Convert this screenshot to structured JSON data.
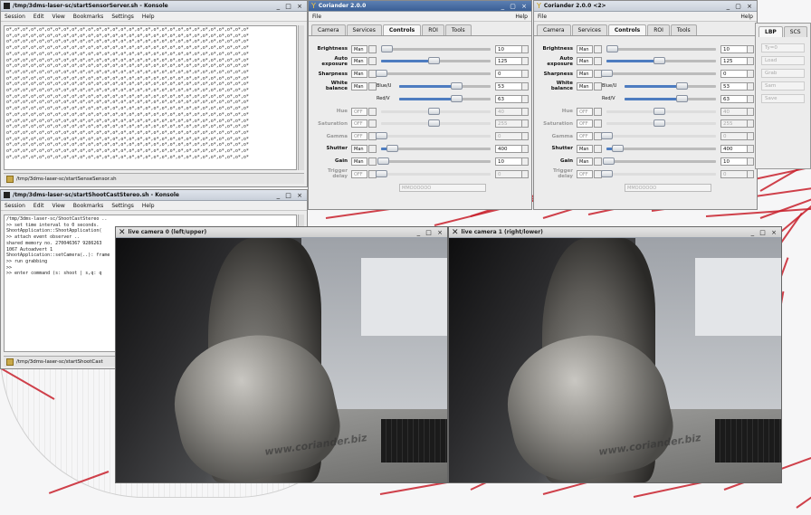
{
  "konsole1": {
    "title": "/tmp/3dms-laser-sc/startSensorServer.sh - Konsole",
    "buttons": "_ □ ×",
    "menu": [
      "Session",
      "Edit",
      "View",
      "Bookmarks",
      "Settings",
      "Help"
    ],
    "tab_label": "/tmp/3dms-laser-sc/startSenseSensor.sh",
    "lines": [
      "o*,o*,o*,o*,o*,o*,o*,o*,o*,o*,o*,o*,o*,o*,o*,o*,o*,o*,o*,o*,o*,o*,o*,o*,o*,o*,o*,o*,o*,o*",
      "o*,o*,o*,o*,o*,o*,o*,o*,o*,o*,o*,o*,o*,o*,o*,o*,o*,o*,o*,o*,o*,o*,o*,o*,o*,o*,o*,o*,o*,o*",
      "o*,o*,o*,o*,o*,o*,o*,o*,o*,o*,o*,o*,o*,o*,o*,o*,o*,o*,o*,o*,o*,o*,o*,o*,o*,o*,o*,o*,o*,o*",
      "o*,o*,o*,o*,o*,o*,o*,o*,o*,o*,o*,o*,o*,o*,o*,o*,o*,o*,o*,o*,o*,o*,o*,o*,o*,o*,o*,o*,o*,o*",
      "o*,o*,o*,o*,o*,o*,o*,o*,o*,o*,o*,o*,o*,o*,o*,o*,o*,o*,o*,o*,o*,o*,o*,o*,o*,o*,o*,o*,o*,o*",
      "o*,o*,o*,o*,o*,o*,o*,o*,o*,o*,o*,o*,o*,o*,o*,o*,o*,o*,o*,o*,o*,o*,o*,o*,o*,o*,o*,o*,o*,o*",
      "o*,o*,o*,o*,o*,o*,o*,o*,o*,o*,o*,o*,o*,o*,o*,o*,o*,o*,o*,o*,o*,o*,o*,o*,o*,o*,o*,o*,o*,o*",
      "o*,o*,o*,o*,o*,o*,o*,o*,o*,o*,o*,o*,o*,o*,o*,o*,o*,o*,o*,o*,o*,o*,o*,o*,o*,o*,o*,o*,o*,o*",
      "o*,o*,o*,o*,o*,o*,o*,o*,o*,o*,o*,o*,o*,o*,o*,o*,o*,o*,o*,o*,o*,o*,o*,o*,o*,o*,o*,o*,o*,o*",
      "o*,o*,o*,o*,o*,o*,o*,o*,o*,o*,o*,o*,o*,o*,o*,o*,o*,o*,o*,o*,o*,o*,o*,o*,o*,o*,o*,o*,o*,o*",
      "o*,o*,o*,o*,o*,o*,o*,o*,o*,o*,o*,o*,o*,o*,o*,o*,o*,o*,o*,o*,o*,o*,o*,o*,o*,o*,o*,o*,o*,o*",
      "o*,o*,o*,o*,o*,o*,o*,o*,o*,o*,o*,o*,o*,o*,o*,o*,o*,o*,o*,o*,o*,o*,o*,o*,o*,o*,o*,o*,o*,o*",
      "o*,o*,o*,o*,o*,o*,o*,o*,o*,o*,o*,o*,o*,o*,o*,o*,o*,o*,o*,o*,o*,o*,o*,o*,o*,o*,o*,o*,o*,o*",
      "o*,o*,o*,o*,o*,o*,o*,o*,o*,o*,o*,o*,o*,o*,o*,o*,o*,o*,o*,o*,o*,o*,o*,o*,o*,o*,o*,o*,o*,o*",
      "o*,o*,o*,o*,o*,o*,o*,o*,o*,o*,o*,o*,o*,o*,o*,o*,o*,o*,o*,o*,o*,o*,o*,o*,o*,o*,o*,o*,o*,o*",
      "o*,o*,o*,o*,o*,o*,o*,o*,o*,o*,o*,o*,o*,o*,o*,o*,o*,o*,o*,o*,o*,o*,o*,o*,o*,o*,o*,o*,o*,o*",
      "o*,o*,o*,o*,o*,o*,o*,o*,o*,o*,o*,o*,o*,o*,o*,o*,o*,o*,o*,o*,o*,o*,o*,o*,o*,o*,o*,o*,o*,o*",
      "o*,o*,o*,o*,o*,o*,o*,o*,o*,o*,o*,o*,o*,o*,o*,o*,o*,o*,o*,o*,o*,o*,o*,o*,o*,o*,o*,o*,o*,o*",
      "o*,o*,o*,o*,o*,o*,o*,o*,o*,o*,o*,o*,o*,o*,o*,o*,o*,o*,o*,o*,o*,o*,o*,o*,o*,o*,o*,o*,o*,o*",
      "o*,o*,o*,o*,o*,o*,o*,o*,o*,o*,o*,o*,o*,o*,o*,o*,o*,o*,o*,o*,o*,o*,o*,o*,o*,o*,o*,o*,o*,o*",
      "o*,o*,o*,o*,o*,o*,o*,o*,o*,o*,o*,o*,o*,o*,o*,o*,o*,o*,o*,o*,o*,o*,o*,o*,o*,o*,o*,o*,o*,o*",
      "o*,o*,o*,o*,o*,o*,o*,o*,o*,o*,o*,o*,o*,o*,o*,o*,o*,o*,o*,o*,o*,o*,o*,o*,o*,o*,o*,o*,o*,o*"
    ]
  },
  "konsole2": {
    "title": "/tmp/3dms-laser-sc/startShootCastStereo.sh - Konsole",
    "buttons": "_ □ ×",
    "menu": [
      "Session",
      "Edit",
      "View",
      "Bookmarks",
      "Settings",
      "Help"
    ],
    "tab_label": "/tmp/3dms-laser-sc/startShootCast",
    "lines": [
      "/tmp/3dms-laser-sc/ShootCastStereo ..",
      ">> set time interval to 0 seconds.",
      "ShootApplication::ShootApplication(",
      ">> attach event observer ..",
      "shared memory no. 270046367 9286263",
      "1067 Autoadvert 1",
      "ShootApplication::setCamera(..): frame",
      ">> run grabbing",
      ">>",
      ">> enter command (s: shoot | s,q: q"
    ]
  },
  "coriander1": {
    "title": "Coriander 2.0.0",
    "file_menu": "File",
    "help_menu": "Help",
    "tabs": [
      "Camera",
      "Services",
      "Controls",
      "ROI",
      "Tools"
    ],
    "rows": [
      {
        "label": "Brightness",
        "mode": "Man",
        "value": "10",
        "pos": 0.05,
        "disabled": false
      },
      {
        "label": "Auto exposure",
        "mode": "Man",
        "value": "125",
        "pos": 0.48,
        "disabled": false
      },
      {
        "label": "Sharpness",
        "mode": "Man",
        "value": "0",
        "pos": 0.0,
        "disabled": false
      },
      {
        "label": "White balance",
        "mode": "Man",
        "value": "53",
        "pos": 0.62,
        "chan": "Blue/U",
        "disabled": false
      },
      {
        "label": "",
        "mode": "",
        "value": "63",
        "pos": 0.62,
        "chan": "Red/V",
        "disabled": false
      },
      {
        "label": "Hue",
        "mode": "OFF",
        "value": "40",
        "pos": 0.48,
        "disabled": true
      },
      {
        "label": "Saturation",
        "mode": "OFF",
        "value": "255",
        "pos": 0.48,
        "disabled": true
      },
      {
        "label": "Gamma",
        "mode": "OFF",
        "value": "0",
        "pos": 0.0,
        "disabled": true
      },
      {
        "label": "Shutter",
        "mode": "Man",
        "value": "400",
        "pos": 0.1,
        "disabled": false
      },
      {
        "label": "Gain",
        "mode": "Man",
        "value": "10",
        "pos": 0.02,
        "disabled": false
      },
      {
        "label": "Trigger delay",
        "mode": "OFF",
        "value": "0",
        "pos": 0.0,
        "disabled": true
      }
    ],
    "trigger_field": "MMOOOOOO"
  },
  "coriander2": {
    "title": "Coriander 2.0.0 <2>",
    "file_menu": "File",
    "help_menu": "Help",
    "tabs": [
      "Camera",
      "Services",
      "Controls",
      "ROI",
      "Tools"
    ],
    "rows": [
      {
        "label": "Brightness",
        "mode": "Man",
        "value": "10",
        "pos": 0.05,
        "disabled": false
      },
      {
        "label": "Auto exposure",
        "mode": "Man",
        "value": "125",
        "pos": 0.48,
        "disabled": false
      },
      {
        "label": "Sharpness",
        "mode": "Man",
        "value": "0",
        "pos": 0.0,
        "disabled": false
      },
      {
        "label": "White balance",
        "mode": "Man",
        "value": "53",
        "pos": 0.62,
        "chan": "Blue/U",
        "disabled": false
      },
      {
        "label": "",
        "mode": "",
        "value": "63",
        "pos": 0.62,
        "chan": "Red/V",
        "disabled": false
      },
      {
        "label": "Hue",
        "mode": "OFF",
        "value": "40",
        "pos": 0.48,
        "disabled": true
      },
      {
        "label": "Saturation",
        "mode": "OFF",
        "value": "255",
        "pos": 0.48,
        "disabled": true
      },
      {
        "label": "Gamma",
        "mode": "OFF",
        "value": "0",
        "pos": 0.0,
        "disabled": true
      },
      {
        "label": "Shutter",
        "mode": "Man",
        "value": "400",
        "pos": 0.1,
        "disabled": false
      },
      {
        "label": "Gain",
        "mode": "Man",
        "value": "10",
        "pos": 0.02,
        "disabled": false
      },
      {
        "label": "Trigger delay",
        "mode": "OFF",
        "value": "0",
        "pos": 0.0,
        "disabled": true
      }
    ],
    "trigger_field": "MMOOOOOO"
  },
  "side_panel": {
    "tabs": [
      "LBP",
      "SCS"
    ],
    "items": [
      "Ty=0",
      "Load",
      "Grab",
      "Sam",
      "Save"
    ]
  },
  "cam_left": {
    "title": "live camera 0 (left/upper)",
    "buttons": "_ □ ×",
    "watermark": "www.coriander.biz"
  },
  "cam_right": {
    "title": "live camera 1 (right/lower)",
    "buttons": "_ □ ×",
    "watermark": "www.coriander.biz"
  },
  "colors": {
    "accent_blue": "#4d7cc0",
    "ray_red": "#c8202c",
    "titlebar_blue": "#3a5f95"
  }
}
